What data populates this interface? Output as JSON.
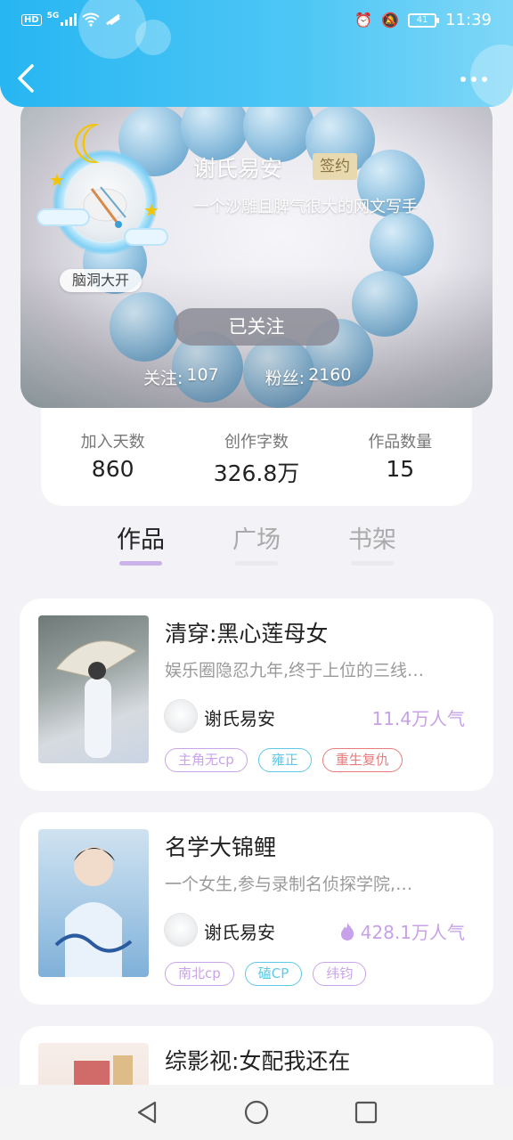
{
  "status_bar": {
    "left_badge": "HD",
    "network": "5G",
    "battery": "41",
    "time": "11:39"
  },
  "header": {
    "back_label": "<",
    "more_label": "•••"
  },
  "profile": {
    "name": "谢氏易安",
    "sign_badge": "签约",
    "bio": "一个沙雕且脾气很大的网文写手",
    "avatar_badge": "脑洞大开",
    "follow_button": "已关注",
    "following_label": "关注:",
    "following_count": "107",
    "fans_label": "粉丝:",
    "fans_count": "2160"
  },
  "stats": [
    {
      "label": "加入天数",
      "value": "860"
    },
    {
      "label": "创作字数",
      "value": "326.8万"
    },
    {
      "label": "作品数量",
      "value": "15"
    }
  ],
  "tabs": [
    {
      "label": "作品",
      "active": true
    },
    {
      "label": "广场",
      "active": false
    },
    {
      "label": "书架",
      "active": false
    }
  ],
  "books": [
    {
      "title": "清穿:黑心莲母女",
      "desc": "娱乐圈隐忍九年,终于上位的三线…",
      "author": "谢氏易安",
      "popularity": "11.4万人气",
      "hot": false,
      "tags": [
        {
          "label": "主角无cp",
          "color": "#c9a4e8"
        },
        {
          "label": "雍正",
          "color": "#5fc8e6"
        },
        {
          "label": "重生复仇",
          "color": "#e87c7c"
        }
      ]
    },
    {
      "title": "名学大锦鲤",
      "desc": "一个女生,参与录制名侦探学院,…",
      "author": "谢氏易安",
      "popularity": "428.1万人气",
      "hot": true,
      "tags": [
        {
          "label": "南北cp",
          "color": "#c9a4e8"
        },
        {
          "label": "磕CP",
          "color": "#5fc8e6"
        },
        {
          "label": "纬钧",
          "color": "#c9a4e8"
        }
      ]
    },
    {
      "title": "综影视:女配我还在",
      "desc": "",
      "author": "",
      "popularity": "",
      "hot": false,
      "tags": []
    }
  ],
  "colors": {
    "header_gradient_start": "#27b6f2",
    "accent_purple": "#c7a1ea",
    "tab_indicator": "#cbb3ea"
  }
}
